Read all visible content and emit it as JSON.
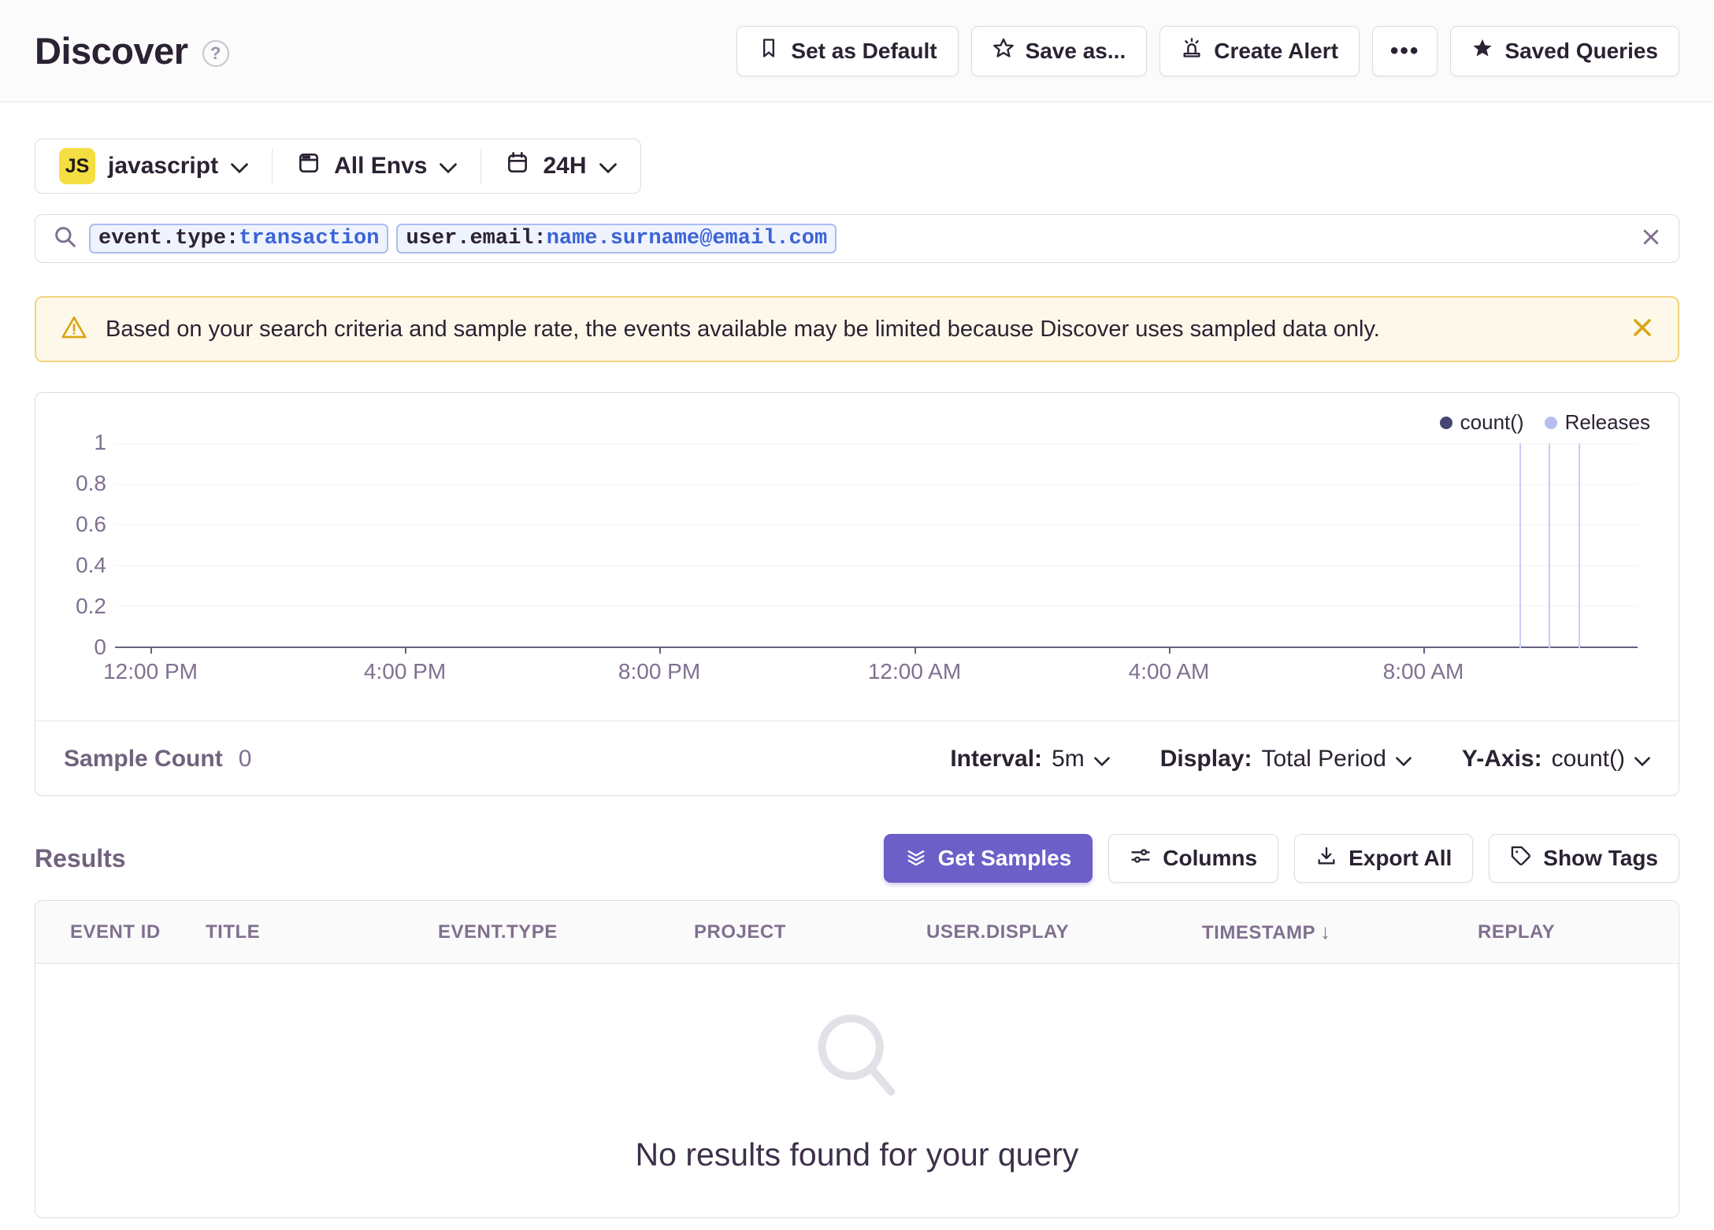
{
  "header": {
    "title": "Discover",
    "help_glyph": "?",
    "actions": {
      "set_as_default": "Set as Default",
      "save_as": "Save as...",
      "create_alert": "Create Alert",
      "more": "•••",
      "saved_queries": "Saved Queries"
    }
  },
  "filters": {
    "project": {
      "badge": "JS",
      "label": "javascript"
    },
    "environment": {
      "label": "All Envs"
    },
    "period": {
      "label": "24H"
    }
  },
  "search": {
    "tokens": [
      {
        "key": "event.type:",
        "value": "transaction"
      },
      {
        "key": "user.email:",
        "value": "name.surname@email.com"
      }
    ]
  },
  "banner": {
    "message": "Based on your search criteria and sample rate, the events available may be limited because Discover uses sampled data only."
  },
  "chart": {
    "legend": [
      {
        "label": "count()",
        "color": "#444674"
      },
      {
        "label": "Releases",
        "color": "#B6BEF0"
      }
    ],
    "y_ticks": {
      "t1": "1",
      "t2": "0.8",
      "t3": "0.6",
      "t4": "0.4",
      "t5": "0.2",
      "t6": "0"
    },
    "x_ticks": {
      "t1": "12:00 PM",
      "t2": "4:00 PM",
      "t3": "8:00 PM",
      "t4": "12:00 AM",
      "t5": "4:00 AM",
      "t6": "8:00 AM"
    },
    "footer": {
      "sample_count_label": "Sample Count",
      "sample_count_value": "0",
      "interval_label": "Interval:",
      "interval_value": "5m",
      "display_label": "Display:",
      "display_value": "Total Period",
      "yaxis_label": "Y-Axis:",
      "yaxis_value": "count()"
    }
  },
  "chart_data": {
    "type": "line",
    "title": "",
    "x": [
      "12:00 PM",
      "4:00 PM",
      "8:00 PM",
      "12:00 AM",
      "4:00 AM",
      "8:00 AM"
    ],
    "series": [
      {
        "name": "count()",
        "values": [
          0,
          0,
          0,
          0,
          0,
          0
        ]
      }
    ],
    "ylim": [
      0,
      1
    ],
    "y_ticks": [
      0,
      0.2,
      0.4,
      0.6,
      0.8,
      1
    ],
    "grid": true,
    "legend_position": "top-right",
    "legend": [
      "count()",
      "Releases"
    ],
    "release_markers_fraction_of_x_range": [
      0.922,
      0.941,
      0.961
    ],
    "note": "No count() data drawn (sample count 0); three vertical release marker lines near the right edge of the 24H window."
  },
  "results": {
    "title": "Results",
    "buttons": {
      "get_samples": "Get Samples",
      "columns": "Columns",
      "export_all": "Export All",
      "show_tags": "Show Tags"
    },
    "table": {
      "columns": {
        "c1": "EVENT ID",
        "c2": "TITLE",
        "c3": "EVENT.TYPE",
        "c4": "PROJECT",
        "c5": "USER.DISPLAY",
        "c6": "TIMESTAMP",
        "c7": "REPLAY"
      },
      "sorted_column": "TIMESTAMP",
      "sort_arrow": "↓",
      "empty_message": "No results found for your query"
    }
  },
  "colors": {
    "accent_purple": "#6C5FC8",
    "text_dark": "#2B2233",
    "text_muted": "#80708F",
    "border": "#DED9E4",
    "warning_bg": "#FDF8E9",
    "warning_border": "#F0D47E",
    "warning_icon": "#D9A513",
    "js_badge_bg": "#F5DE41",
    "token_value_blue": "#3B63D8",
    "release_line": "#C9CEF4",
    "count_series": "#444674"
  }
}
